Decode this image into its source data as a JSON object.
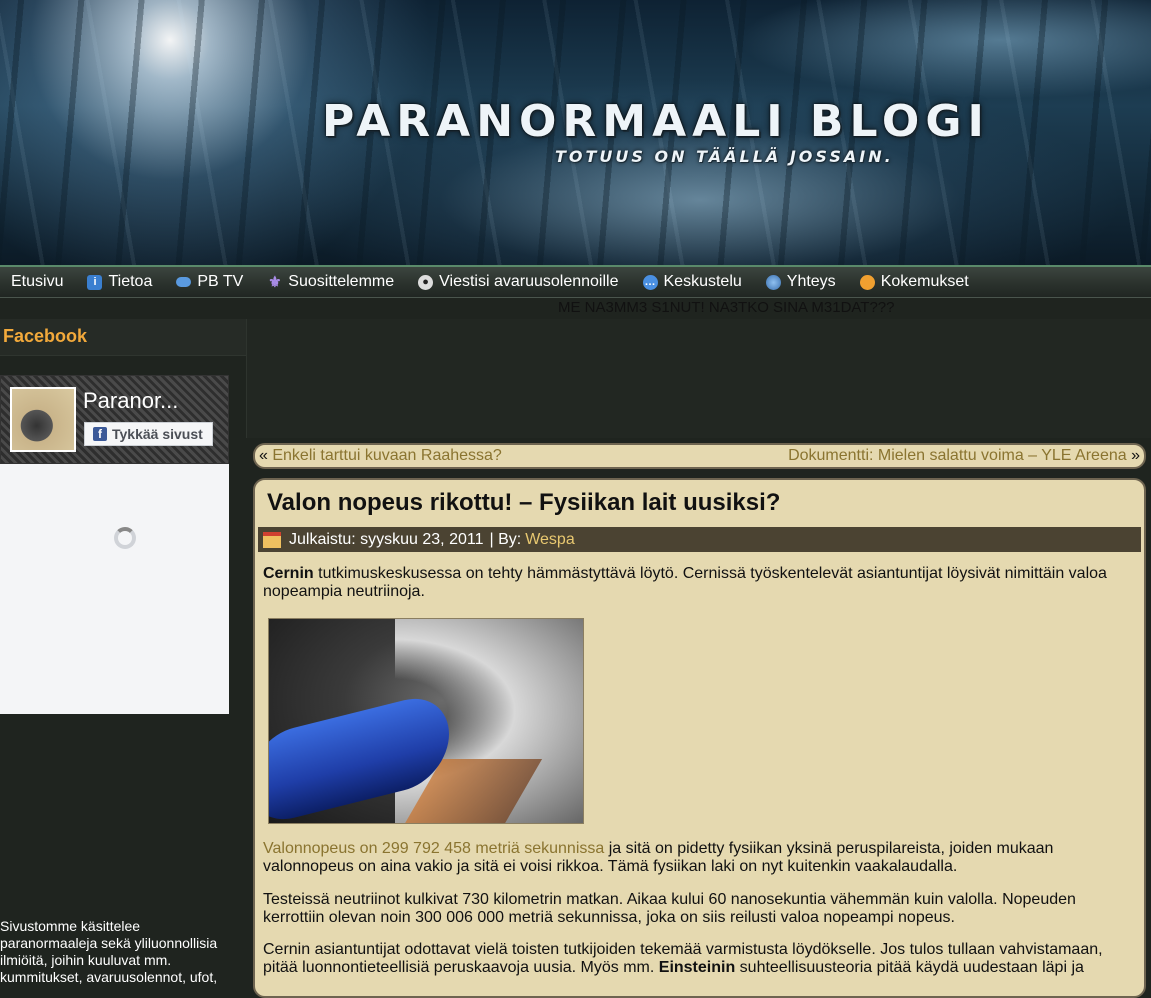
{
  "header": {
    "title": "PARANORMAALI BLOGI",
    "tagline": "TOTUUS ON TÄÄLLÄ JOSSAIN."
  },
  "nav": {
    "items": [
      {
        "label": "Etusivu",
        "icon": ""
      },
      {
        "label": "Tietoa",
        "icon": "info-icon"
      },
      {
        "label": "PB TV",
        "icon": "tv-icon"
      },
      {
        "label": "Suosittelemme",
        "icon": "star-icon"
      },
      {
        "label": "Viestisi avaruusolennoille",
        "icon": "alien-icon"
      },
      {
        "label": "Keskustelu",
        "icon": "chat-icon"
      },
      {
        "label": "Yhteys",
        "icon": "globe-icon"
      },
      {
        "label": "Kokemukset",
        "icon": "person-icon"
      }
    ]
  },
  "marquee": "ME NA3MM3 S1NUT! NA3TKO SINA M31DAT???",
  "sidebar": {
    "facebook_title": "Facebook",
    "page_name": "Paranor...",
    "like_label": "Tykkää sivust",
    "description": "Sivustomme käsittelee paranormaaleja sekä yliluonnollisia ilmiöitä, joihin kuuluvat mm. kummitukset, avaruusolennot, ufot,"
  },
  "post_nav": {
    "prev": "Enkeli tarttui kuvaan Raahessa?",
    "next": "Dokumentti: Mielen salattu voima – YLE Areena",
    "prev_arrow": "«",
    "next_arrow": "»"
  },
  "post": {
    "title": "Valon nopeus rikottu! – Fysiikan lait uusiksi?",
    "meta_published": "Julkaistu: syyskuu 23, 2011",
    "meta_by": "| By:",
    "author": "Wespa",
    "p1_bold": "Cernin",
    "p1_rest": " tutkimuskeskusessa on tehty hämmästyttävä löytö. Cernissä työskentelevät asiantuntijat löysivät nimittäin valoa nopeampia neutriinoja.",
    "p2_link": "Valonnopeus on 299 792 458 metriä sekunnissa",
    "p2_rest": " ja sitä on pidetty fysiikan yksinä peruspilareista, joiden mukaan valonnopeus on aina vakio ja sitä ei voisi rikkoa. Tämä fysiikan laki on nyt kuitenkin vaakalaudalla.",
    "p3": "Testeissä neutriinot kulkivat 730 kilometrin matkan. Aikaa kului 60 nanosekuntia vähemmän kuin valolla. Nopeuden kerrottiin olevan noin 300 006 000 metriä sekunnissa, joka on siis reilusti valoa nopeampi nopeus.",
    "p4_start": "Cernin asiantuntijat odottavat vielä toisten tutkijoiden tekemää varmistusta löydökselle. Jos tulos tullaan vahvistamaan, pitää luonnontieteellisiä peruskaavoja uusia. Myös mm. ",
    "p4_bold": "Einsteinin",
    "p4_end": " suhteellisuusteoria pitää käydä uudestaan läpi ja"
  }
}
